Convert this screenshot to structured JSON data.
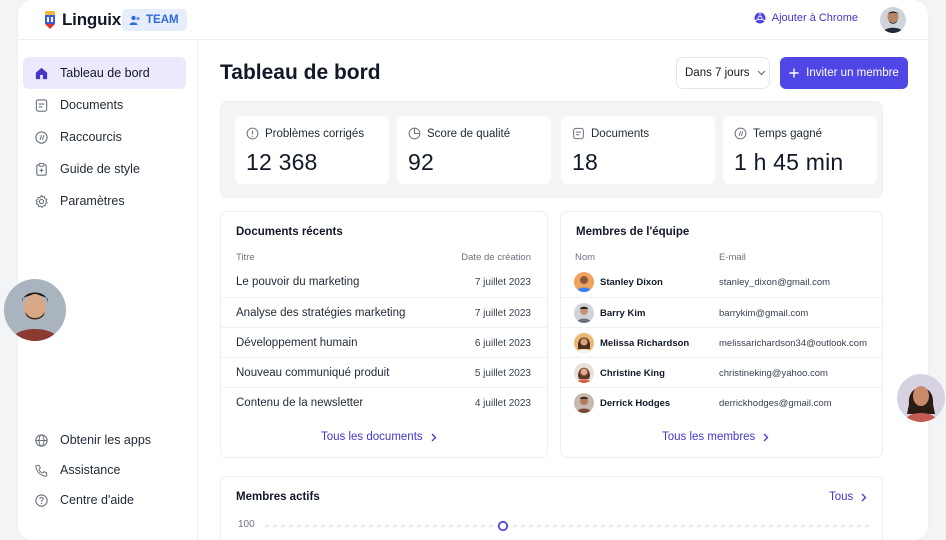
{
  "header": {
    "brand": "Linguix",
    "team_badge": "TEAM",
    "chrome_link": "Ajouter à Chrome"
  },
  "sidebar": {
    "items": [
      {
        "label": "Tableau de bord",
        "icon": "home-icon"
      },
      {
        "label": "Documents",
        "icon": "document-icon"
      },
      {
        "label": "Raccourcis",
        "icon": "shortcut-icon"
      },
      {
        "label": "Guide de style",
        "icon": "clipboard-icon"
      },
      {
        "label": "Paramètres",
        "icon": "gear-icon"
      }
    ],
    "bottom_items": [
      {
        "label": "Obtenir les apps",
        "icon": "globe-icon"
      },
      {
        "label": "Assistance",
        "icon": "phone-icon"
      },
      {
        "label": "Centre d'aide",
        "icon": "help-icon"
      }
    ]
  },
  "main": {
    "title": "Tableau de bord",
    "period": "Dans 7 jours",
    "invite_label": "Inviter un membre"
  },
  "stats": [
    {
      "label": "Problèmes corrigés",
      "value": "12 368",
      "icon": "alert-circle-icon"
    },
    {
      "label": "Score de qualité",
      "value": "92",
      "icon": "pie-chart-icon"
    },
    {
      "label": "Documents",
      "value": "18",
      "icon": "document-icon"
    },
    {
      "label": "Temps gagné",
      "value": "1 h 45 min",
      "icon": "shortcut-icon"
    }
  ],
  "recent_docs": {
    "title": "Documents récents",
    "col_title": "Titre",
    "col_date": "Date de création",
    "rows": [
      {
        "title": "Le pouvoir du marketing",
        "date": "7 juillet 2023"
      },
      {
        "title": "Analyse des stratégies marketing",
        "date": "7 juillet 2023"
      },
      {
        "title": "Développement humain",
        "date": "6 juillet 2023"
      },
      {
        "title": "Nouveau communiqué produit",
        "date": "5 juillet 2023"
      },
      {
        "title": "Contenu de la newsletter",
        "date": "4 juillet 2023"
      }
    ],
    "link": "Tous les documents"
  },
  "team": {
    "title": "Membres de l'équipe",
    "col_name": "Nom",
    "col_email": "E-mail",
    "rows": [
      {
        "name": "Stanley Dixon",
        "email": "stanley_dixon@gmail.com"
      },
      {
        "name": "Barry Kim",
        "email": "barrykim@gmail.com"
      },
      {
        "name": "Melissa Richardson",
        "email": "melissarichardson34@outlook.com"
      },
      {
        "name": "Christine King",
        "email": "christineking@yahoo.com"
      },
      {
        "name": "Derrick Hodges",
        "email": "derrickhodges@gmail.com"
      }
    ],
    "link": "Tous les membres"
  },
  "active_members": {
    "title": "Membres actifs",
    "link": "Tous",
    "y_tick": "100"
  },
  "colors": {
    "accent": "#4f46e5",
    "link": "#4338ca",
    "active_nav_bg": "#ebe9fb",
    "team_badge_bg": "#e6eefc"
  }
}
